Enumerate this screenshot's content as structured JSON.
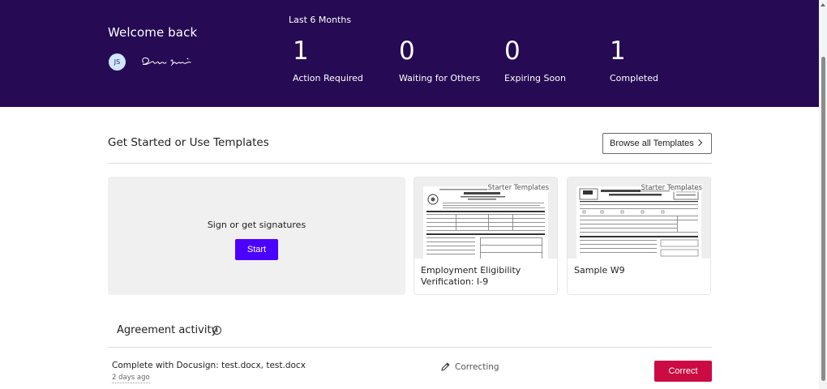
{
  "header": {
    "welcome": "Welcome back",
    "avatar_initials": "JS",
    "period": "Last 6 Months",
    "stats": [
      {
        "value": "1",
        "label": "Action Required"
      },
      {
        "value": "0",
        "label": "Waiting for Others"
      },
      {
        "value": "0",
        "label": "Expiring Soon"
      },
      {
        "value": "1",
        "label": "Completed"
      }
    ]
  },
  "templates": {
    "title": "Get Started or Use Templates",
    "browse_label": "Browse all Templates",
    "start_card": {
      "text": "Sign or get signatures",
      "button": "Start"
    },
    "cards": [
      {
        "tag": "Starter Templates",
        "name": "Employment Eligibility Verification: I-9"
      },
      {
        "tag": "Starter Templates",
        "name": "Sample W9"
      }
    ]
  },
  "activity": {
    "title": "Agreement activity",
    "rows": [
      {
        "title": "Complete with Docusign: test.docx, test.docx",
        "time": "2 days ago",
        "status": "Correcting",
        "action": "Correct"
      }
    ]
  },
  "colors": {
    "hero_bg": "#260a53",
    "primary": "#4c00ff",
    "danger": "#cc0a43"
  }
}
